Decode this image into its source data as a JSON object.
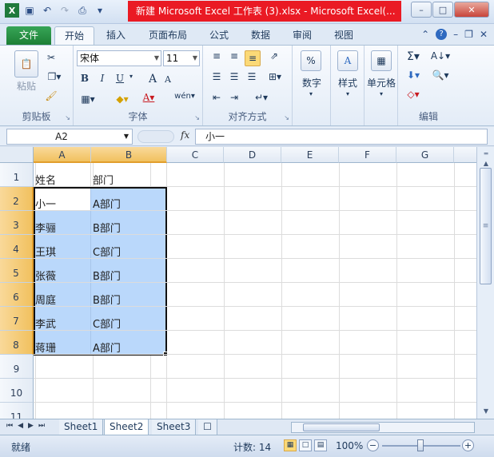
{
  "window": {
    "title": "新建 Microsoft Excel 工作表 (3).xlsx - Microsoft Excel(...",
    "qat_icons": [
      "excel-icon",
      "save-icon",
      "undo-icon",
      "redo-icon",
      "print-preview-icon",
      "customize-qat-icon"
    ]
  },
  "tabs": [
    "文件",
    "开始",
    "插入",
    "页面布局",
    "公式",
    "数据",
    "审阅",
    "视图"
  ],
  "active_tab": "开始",
  "ribbon": {
    "clipboard": {
      "paste": "粘贴",
      "label": "剪贴板"
    },
    "font": {
      "name": "宋体",
      "size": "11",
      "label": "字体",
      "bold": "B",
      "italic": "I",
      "underline": "U",
      "grow": "A",
      "shrink": "A",
      "phonetic": "wén"
    },
    "alignment": {
      "label": "对齐方式"
    },
    "number": {
      "label": "数字",
      "symbol": "%"
    },
    "styles": {
      "label": "样式",
      "symbol": "A"
    },
    "cells": {
      "label": "单元格"
    },
    "editing": {
      "label": "编辑",
      "sum": "Σ"
    }
  },
  "formula_bar": {
    "name_box": "A2",
    "fx": "fx",
    "value": "小一"
  },
  "columns": [
    "A",
    "B",
    "C",
    "D",
    "E",
    "F",
    "G"
  ],
  "rows": [
    "1",
    "2",
    "3",
    "4",
    "5",
    "6",
    "7",
    "8",
    "9",
    "10",
    "11"
  ],
  "cells": [
    [
      "姓名",
      "部门"
    ],
    [
      "小一",
      "A部门"
    ],
    [
      "李骊",
      "B部门"
    ],
    [
      "王琪",
      "C部门"
    ],
    [
      "张薇",
      "B部门"
    ],
    [
      "周庭",
      "B部门"
    ],
    [
      "李武",
      "C部门"
    ],
    [
      "蒋珊",
      "A部门"
    ]
  ],
  "sheets": [
    "Sheet1",
    "Sheet2",
    "Sheet3"
  ],
  "active_sheet": "Sheet2",
  "status": {
    "mode": "就绪",
    "count": "计数: 14",
    "zoom": "100%"
  }
}
